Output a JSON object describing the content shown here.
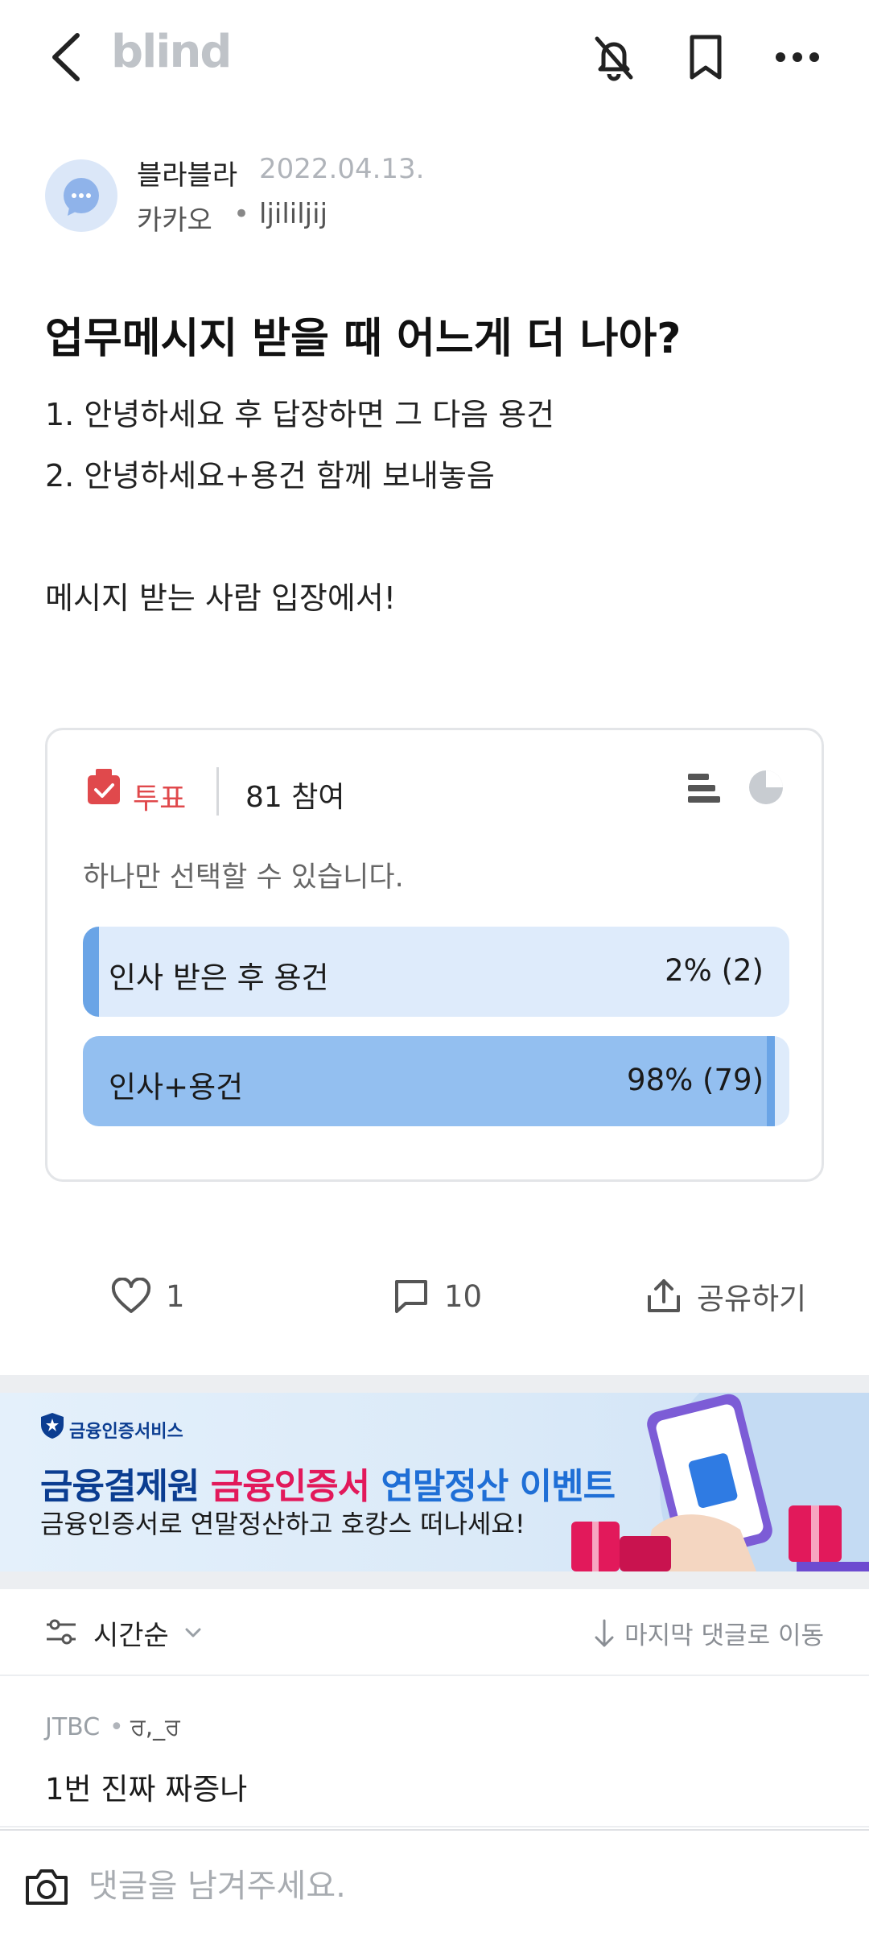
{
  "header": {
    "logo": "blind",
    "icons": [
      "back-chevron-icon",
      "notification-off-icon",
      "bookmark-icon",
      "more-icon"
    ]
  },
  "author": {
    "nickname": "블라블라",
    "date": "2022.04.13.",
    "company": "카카오",
    "separator": "•",
    "user_id": "ljililjij"
  },
  "post": {
    "title": "업무메시지 받을 때 어느게 더 나아?",
    "lines": [
      "1. 안녕하세요 후 답장하면 그 다음 용건",
      "2. 안녕하세요+용건 함께 보내놓음",
      "메시지 받는 사람 입장에서!"
    ]
  },
  "poll": {
    "label": "투표",
    "participants": "81 참여",
    "hint": "하나만 선택할 수 있습니다.",
    "options": [
      {
        "label": "인사 받은 후 용건",
        "result": "2% (2)",
        "percent": 2
      },
      {
        "label": "인사+용건",
        "result": "98% (79)",
        "percent": 98
      }
    ],
    "colors": {
      "track": "#deebfb",
      "fill": "#93bff0",
      "accent": "#e0494c"
    }
  },
  "actions": {
    "likes": "1",
    "comments": "10",
    "share": "공유하기"
  },
  "banner": {
    "brand": "금융인증서비스",
    "title_part1": "금융결제원 ",
    "title_part2": "금융인증서",
    "title_part3": " 연말정산 이벤트",
    "subtitle": "금융인증서로 연말정산하고 호캉스 떠나세요!",
    "colors": {
      "navy": "#0b3d91",
      "pink": "#e2195b",
      "blue": "#1f6fd6"
    }
  },
  "comments_bar": {
    "sort_label": "시간순",
    "jump_label": "마지막 댓글로 이동"
  },
  "comment": {
    "company": "JTBC",
    "separator": "•",
    "user": "ਰ,_ਰ",
    "text": "1번 진짜 짜증나"
  },
  "input": {
    "placeholder": "댓글을 남겨주세요."
  }
}
